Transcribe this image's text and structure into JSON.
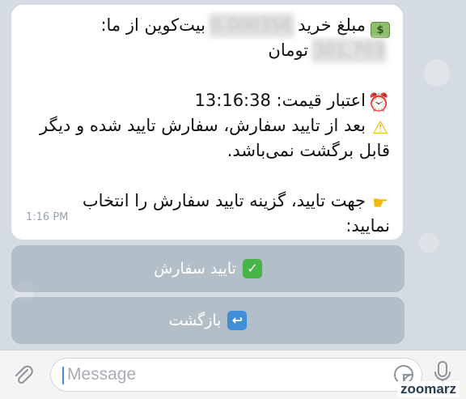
{
  "message": {
    "line1_text": "مبلغ خرید",
    "line1_blurred": "0.000356",
    "line1_suffix": "بیت‌کوین از ما:",
    "line2_blurred": "301,703",
    "line2_text": "تومان",
    "line3_text": "اعتبار قیمت: 13:16:38",
    "line4_text": "بعد از تایید سفارش، سفارش تایید شده و دیگر",
    "line5_text": "قابل برگشت نمی‌باشد.",
    "line6_text": "جهت تایید، گزینه تایید سفارش را انتخاب",
    "line7_text": "نمایید:",
    "time": "1:16 PM"
  },
  "icons": {
    "money": "money-icon",
    "alarm": "alarm-clock-icon",
    "warning": "warning-icon",
    "hand": "pointing-hand-icon",
    "check": "check-icon",
    "back": "back-arrow-icon"
  },
  "buttons": {
    "confirm_label": "تایید سفارش",
    "back_label": "بازگشت"
  },
  "composer": {
    "placeholder": "Message"
  },
  "watermark": "zoomarz",
  "colors": {
    "accent": "#3d8eea",
    "check_green": "#48b548",
    "back_blue": "#3f8fd8"
  }
}
